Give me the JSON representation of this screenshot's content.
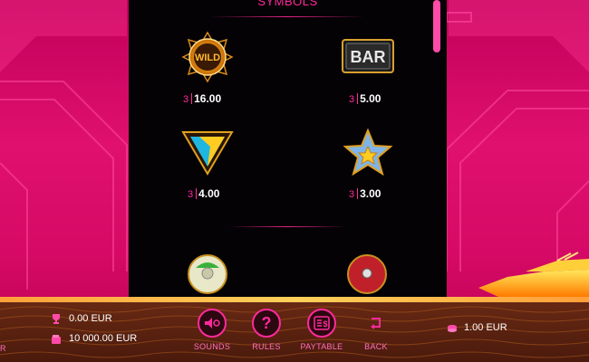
{
  "panel": {
    "title": "SYMBOLS"
  },
  "symbols": [
    {
      "name": "WILD",
      "count": "3",
      "value": "16.00"
    },
    {
      "name": "BAR",
      "count": "3",
      "value": "5.00"
    },
    {
      "name": "triangle",
      "count": "3",
      "value": "4.00"
    },
    {
      "name": "star",
      "count": "3",
      "value": "3.00"
    }
  ],
  "symbol_text": {
    "wild": "WILD",
    "bar": "BAR"
  },
  "balance": {
    "win_value": "0.00 EUR",
    "credit_value": "10 000.00 EUR",
    "bet_value": "1.00 EUR"
  },
  "controls": {
    "sounds": "SOUNDS",
    "rules": "RULES",
    "paytable": "PAYTABLE",
    "back": "BACK"
  },
  "left_edge": "R",
  "icons": {
    "win": "trophy-icon",
    "credit": "wallet-icon",
    "bet": "coins-icon",
    "sounds": "speaker-icon",
    "rules": "question-icon",
    "paytable": "paytable-icon",
    "back": "back-arrow-icon"
  },
  "colors": {
    "accent": "#ff2a9c",
    "background": "#d60a66",
    "panel": "#050205"
  }
}
